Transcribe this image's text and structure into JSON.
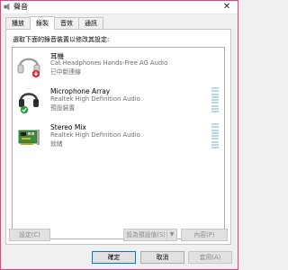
{
  "window": {
    "title": "聲音",
    "close_glyph": "✕"
  },
  "tabs": [
    {
      "label": "播放"
    },
    {
      "label": "錄製"
    },
    {
      "label": "音效"
    },
    {
      "label": "通訊"
    }
  ],
  "active_tab_index": 1,
  "instruction": "選取下面的錄音裝置以修改其設定:",
  "devices": [
    {
      "name": "耳機",
      "description": "Cat Headphones Hands-Free AG Audio",
      "status": "已中斷連線",
      "icon": "headset-icon",
      "badge": "disconnected-badge-icon"
    },
    {
      "name": "Microphone Array",
      "description": "Realtek High Definition Audio",
      "status": "預設裝置",
      "icon": "microphone-headset-icon",
      "badge": "default-check-icon"
    },
    {
      "name": "Stereo Mix",
      "description": "Realtek High Definition Audio",
      "status": "就緒",
      "icon": "sound-card-icon",
      "badge": ""
    }
  ],
  "buttons": {
    "configure": "設定(C)",
    "set_default": "設為預設值(S)",
    "set_default_arrow": "▼",
    "properties": "內容(P)",
    "ok": "確定",
    "cancel": "取消",
    "apply": "套用(A)"
  },
  "colors": {
    "window_border": "#e83e8c",
    "level_meter": "#b9d5e6",
    "default_badge": "#2e9e3e",
    "disconnected_badge": "#d13438"
  }
}
